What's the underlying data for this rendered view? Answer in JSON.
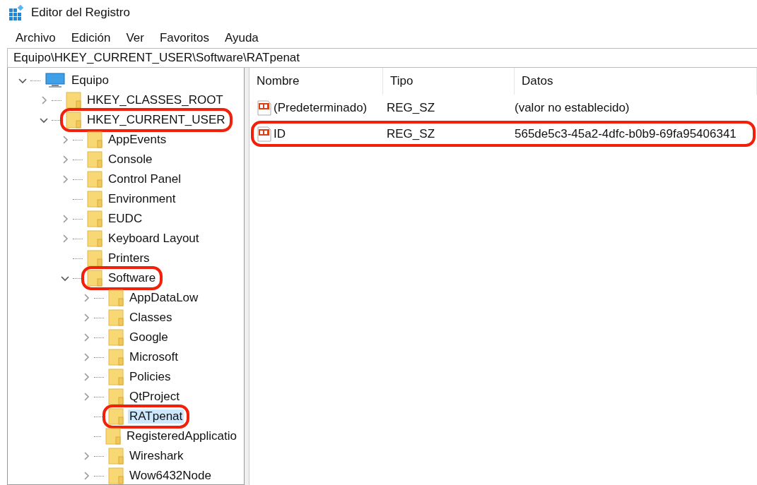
{
  "window": {
    "title": "Editor del Registro"
  },
  "menu": [
    "Archivo",
    "Edición",
    "Ver",
    "Favoritos",
    "Ayuda"
  ],
  "address": "Equipo\\HKEY_CURRENT_USER\\Software\\RATpenat",
  "tree": [
    {
      "label": "Equipo",
      "kind": "computer",
      "has_children": true,
      "expanded": true,
      "selected": false,
      "highlighted": false,
      "children": [
        {
          "label": "HKEY_CLASSES_ROOT",
          "kind": "folder",
          "has_children": true,
          "expanded": false,
          "selected": false,
          "highlighted": false
        },
        {
          "label": "HKEY_CURRENT_USER",
          "kind": "folder",
          "has_children": true,
          "expanded": true,
          "selected": false,
          "highlighted": true,
          "children": [
            {
              "label": "AppEvents",
              "kind": "folder",
              "has_children": true,
              "expanded": false,
              "selected": false,
              "highlighted": false
            },
            {
              "label": "Console",
              "kind": "folder",
              "has_children": true,
              "expanded": false,
              "selected": false,
              "highlighted": false
            },
            {
              "label": "Control Panel",
              "kind": "folder",
              "has_children": true,
              "expanded": false,
              "selected": false,
              "highlighted": false
            },
            {
              "label": "Environment",
              "kind": "folder",
              "has_children": false,
              "expanded": false,
              "selected": false,
              "highlighted": false
            },
            {
              "label": "EUDC",
              "kind": "folder",
              "has_children": true,
              "expanded": false,
              "selected": false,
              "highlighted": false
            },
            {
              "label": "Keyboard Layout",
              "kind": "folder",
              "has_children": true,
              "expanded": false,
              "selected": false,
              "highlighted": false
            },
            {
              "label": "Printers",
              "kind": "folder",
              "has_children": false,
              "expanded": false,
              "selected": false,
              "highlighted": false
            },
            {
              "label": "Software",
              "kind": "folder",
              "has_children": true,
              "expanded": true,
              "selected": false,
              "highlighted": true,
              "children": [
                {
                  "label": "AppDataLow",
                  "kind": "folder",
                  "has_children": true,
                  "expanded": false,
                  "selected": false,
                  "highlighted": false
                },
                {
                  "label": "Classes",
                  "kind": "folder",
                  "has_children": true,
                  "expanded": false,
                  "selected": false,
                  "highlighted": false
                },
                {
                  "label": "Google",
                  "kind": "folder",
                  "has_children": true,
                  "expanded": false,
                  "selected": false,
                  "highlighted": false
                },
                {
                  "label": "Microsoft",
                  "kind": "folder",
                  "has_children": true,
                  "expanded": false,
                  "selected": false,
                  "highlighted": false
                },
                {
                  "label": "Policies",
                  "kind": "folder",
                  "has_children": true,
                  "expanded": false,
                  "selected": false,
                  "highlighted": false
                },
                {
                  "label": "QtProject",
                  "kind": "folder",
                  "has_children": true,
                  "expanded": false,
                  "selected": false,
                  "highlighted": false
                },
                {
                  "label": "RATpenat",
                  "kind": "folder",
                  "has_children": false,
                  "expanded": false,
                  "selected": true,
                  "highlighted": true
                },
                {
                  "label": "RegisteredApplicatio",
                  "kind": "folder",
                  "has_children": false,
                  "expanded": false,
                  "selected": false,
                  "highlighted": false
                },
                {
                  "label": "Wireshark",
                  "kind": "folder",
                  "has_children": true,
                  "expanded": false,
                  "selected": false,
                  "highlighted": false
                },
                {
                  "label": "Wow6432Node",
                  "kind": "folder",
                  "has_children": true,
                  "expanded": false,
                  "selected": false,
                  "highlighted": false
                }
              ]
            }
          ]
        }
      ]
    }
  ],
  "table": {
    "columns": [
      "Nombre",
      "Tipo",
      "Datos"
    ],
    "rows": [
      {
        "cells": [
          "(Predeterminado)",
          "REG_SZ",
          "(valor no establecido)"
        ],
        "highlighted": false
      },
      {
        "cells": [
          "ID",
          "REG_SZ",
          "565de5c3-45a2-4dfc-b0b9-69fa95406341"
        ],
        "highlighted": true
      }
    ]
  }
}
